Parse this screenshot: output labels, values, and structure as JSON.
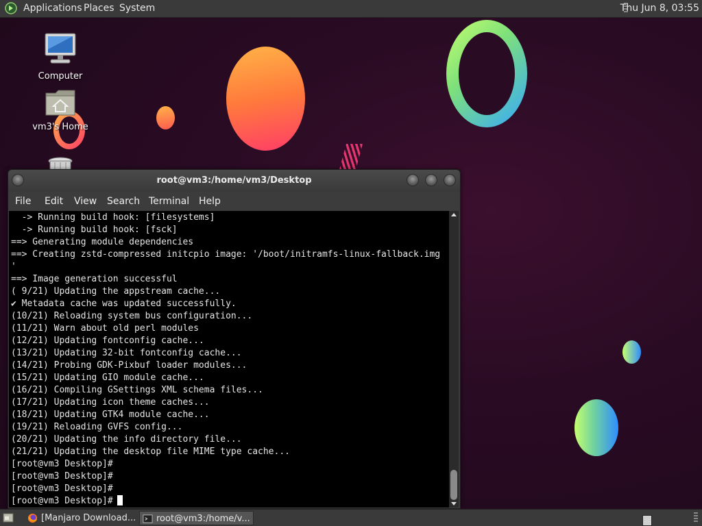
{
  "top_panel": {
    "menus": [
      "Applications",
      "Places",
      "System"
    ],
    "clock": "Thu Jun  8, 03:55"
  },
  "desktop": {
    "icons": [
      {
        "label": "Computer",
        "icon": "computer-icon"
      },
      {
        "label": "vm3's Home",
        "icon": "home-folder-icon"
      },
      {
        "label": "",
        "icon": "trash-icon"
      }
    ]
  },
  "terminal": {
    "title": "root@vm3:/home/vm3/Desktop",
    "menu": [
      "File",
      "Edit",
      "View",
      "Search",
      "Terminal",
      "Help"
    ],
    "lines": [
      "  -> Running build hook: [filesystems]",
      "  -> Running build hook: [fsck]",
      "==> Generating module dependencies",
      "==> Creating zstd-compressed initcpio image: '/boot/initramfs-linux-fallback.img",
      "'",
      "==> Image generation successful",
      "( 9/21) Updating the appstream cache...",
      "✔ Metadata cache was updated successfully.",
      "(10/21) Reloading system bus configuration...",
      "(11/21) Warn about old perl modules",
      "(12/21) Updating fontconfig cache...",
      "(13/21) Updating 32-bit fontconfig cache...",
      "(14/21) Probing GDK-Pixbuf loader modules...",
      "(15/21) Updating GIO module cache...",
      "(16/21) Compiling GSettings XML schema files...",
      "(17/21) Updating icon theme caches...",
      "(18/21) Updating GTK4 module cache...",
      "(19/21) Reloading GVFS config...",
      "(20/21) Updating the info directory file...",
      "(21/21) Updating the desktop file MIME type cache...",
      "[root@vm3 Desktop]#",
      "[root@vm3 Desktop]#",
      "[root@vm3 Desktop]#"
    ],
    "prompt": "[root@vm3 Desktop]#"
  },
  "taskbar": {
    "tasks": [
      {
        "label": "[Manjaro Download...",
        "icon": "firefox-icon"
      },
      {
        "label": "root@vm3:/home/v...",
        "icon": "terminal-icon"
      }
    ]
  },
  "colors": {
    "panel": "#3a3a3a",
    "terminal_bg": "#000000",
    "terminal_fg": "#e6e6e6",
    "desktop_bg": "#2a0b24"
  }
}
